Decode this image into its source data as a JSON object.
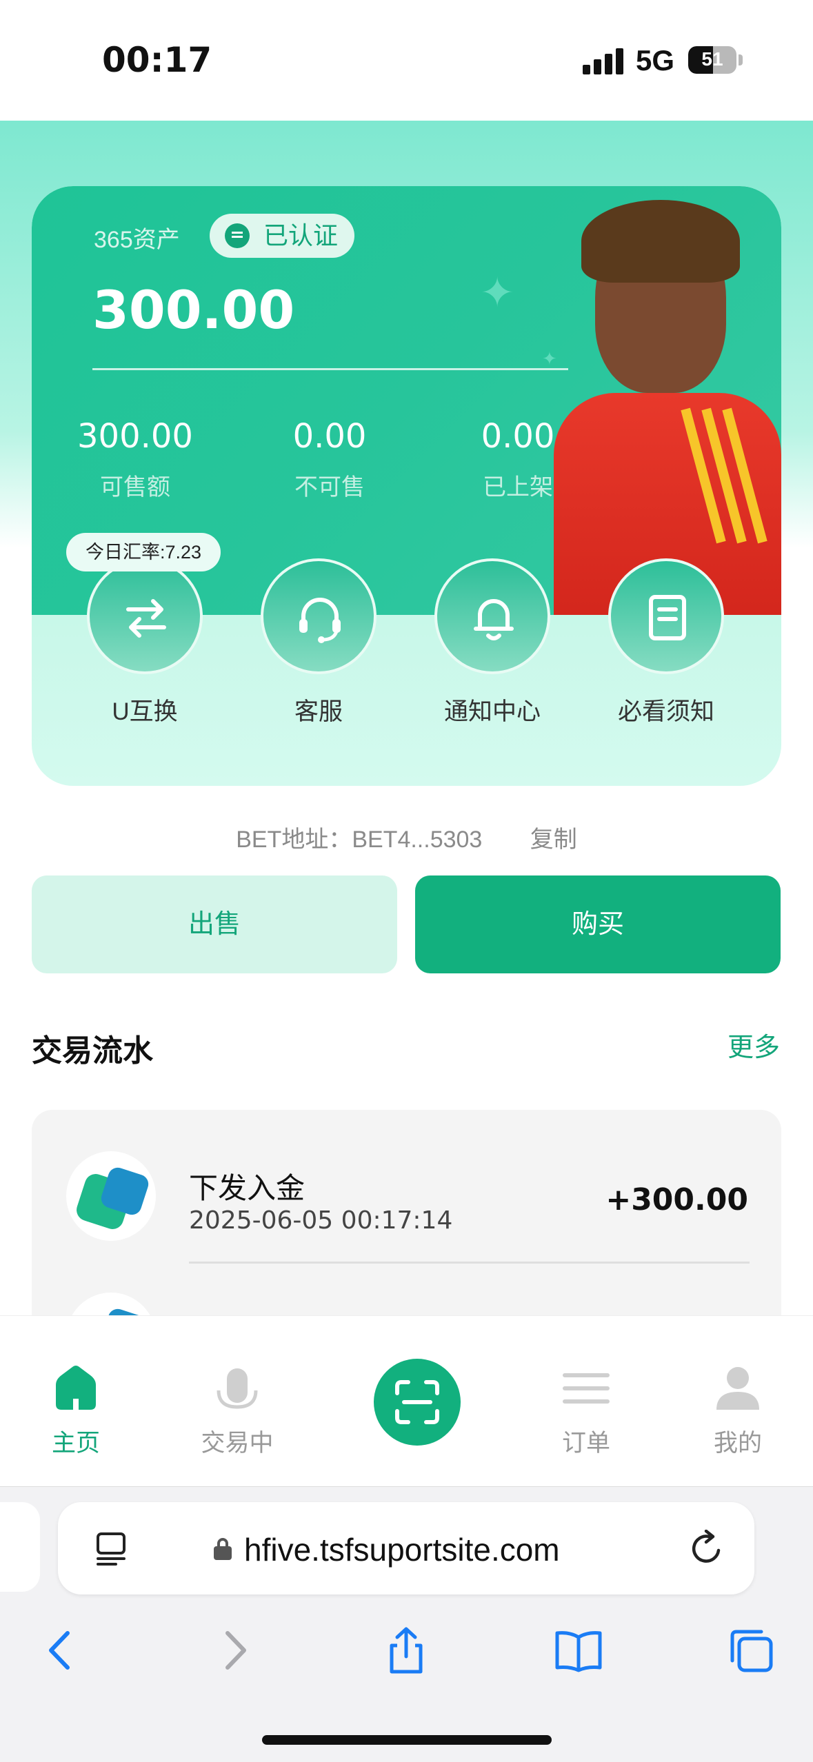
{
  "status_bar": {
    "time": "00:17",
    "network": "5G",
    "battery": "51",
    "battery_level_percent": 51
  },
  "asset": {
    "label": "365资产",
    "verified": "已认证",
    "balance": "300.00",
    "stats": [
      {
        "value": "300.00",
        "label": "可售额"
      },
      {
        "value": "0.00",
        "label": "不可售"
      },
      {
        "value": "0.00",
        "label": "已上架"
      }
    ],
    "rate": "今日汇率:7.23"
  },
  "actions": [
    {
      "label": "U互换",
      "icon": "swap-icon"
    },
    {
      "label": "客服",
      "icon": "headset-icon"
    },
    {
      "label": "通知中心",
      "icon": "bell-icon"
    },
    {
      "label": "必看须知",
      "icon": "document-icon"
    }
  ],
  "address": {
    "text": "BET地址：BET4...5303",
    "copy": "复制"
  },
  "buttons": {
    "sell": "出售",
    "buy": "购买"
  },
  "transactions": {
    "title": "交易流水",
    "more": "更多",
    "items": [
      {
        "title": "下发入金",
        "date": "2025-06-05 00:17:14",
        "amount": "+300.00"
      }
    ]
  },
  "bottom_nav": {
    "items": [
      {
        "label": "主页",
        "icon": "home-icon",
        "active": true
      },
      {
        "label": "交易中",
        "icon": "trading-icon",
        "active": false
      },
      {
        "label": "",
        "icon": "scan-icon",
        "active": false
      },
      {
        "label": "订单",
        "icon": "list-icon",
        "active": false
      },
      {
        "label": "我的",
        "icon": "user-icon",
        "active": false
      }
    ]
  },
  "browser": {
    "url": "hfive.tsfsuportsite.com"
  },
  "colors": {
    "accent": "#12b07e",
    "card_green": "#27c59b",
    "light_green": "#d4f5ea"
  }
}
